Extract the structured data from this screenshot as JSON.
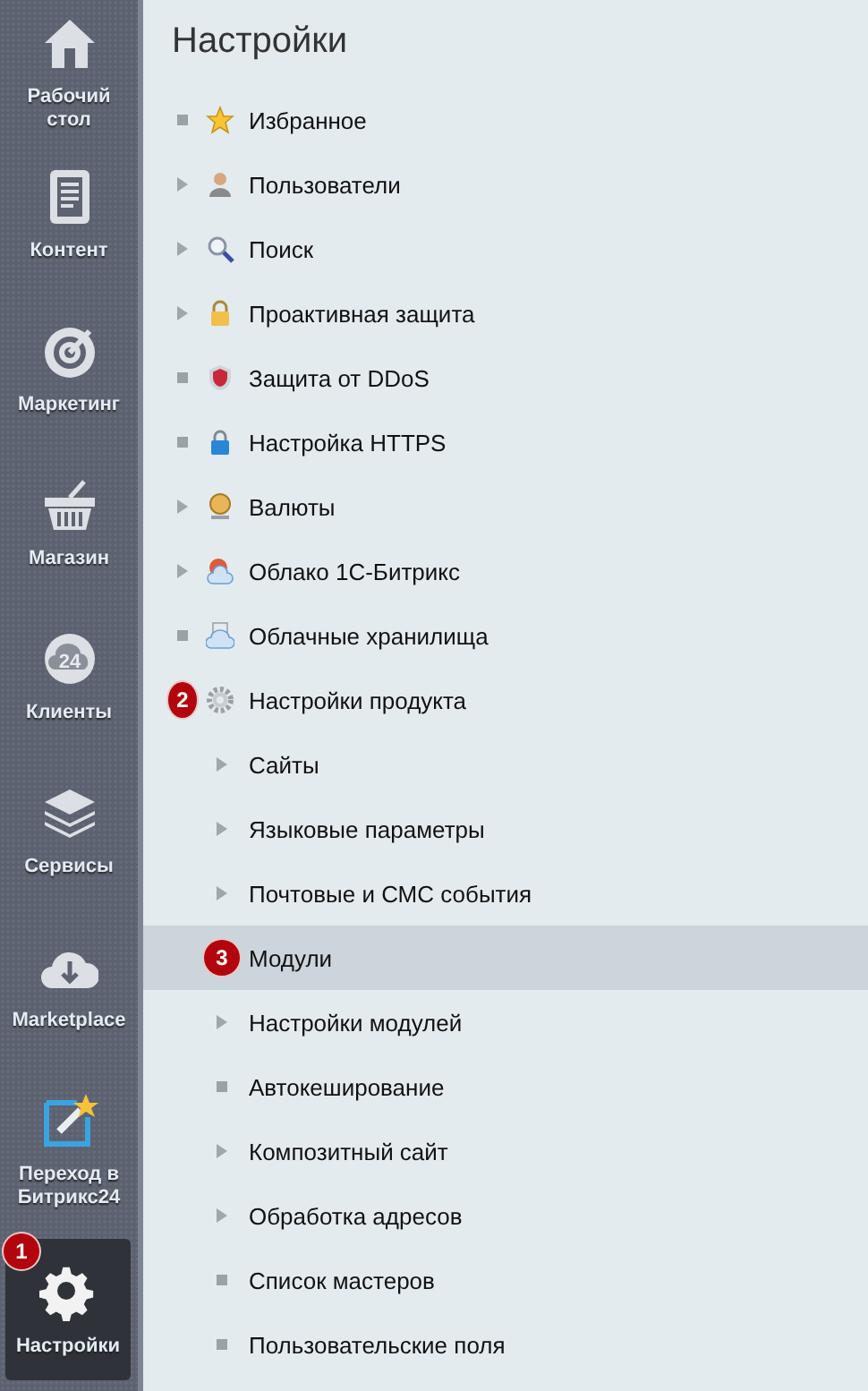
{
  "sidebar": {
    "items": [
      {
        "label": "Рабочий стол",
        "selected": false
      },
      {
        "label": "Контент",
        "selected": false
      },
      {
        "label": "Маркетинг",
        "selected": false
      },
      {
        "label": "Магазин",
        "selected": false
      },
      {
        "label": "Клиенты",
        "selected": false,
        "icon_text": "24"
      },
      {
        "label": "Сервисы",
        "selected": false
      },
      {
        "label": "Marketplace",
        "selected": false
      },
      {
        "label": "Переход в Битрикс24",
        "selected": false
      },
      {
        "label": "Настройки",
        "selected": true,
        "badge": "1"
      }
    ]
  },
  "title": "Настройки",
  "menu": {
    "items": [
      {
        "label": "Избранное",
        "kind": "dot",
        "selected": false
      },
      {
        "label": "Пользователи",
        "kind": "arrow",
        "selected": false
      },
      {
        "label": "Поиск",
        "kind": "arrow",
        "selected": false
      },
      {
        "label": "Проактивная защита",
        "kind": "arrow",
        "selected": false
      },
      {
        "label": "Защита от DDoS",
        "kind": "dot",
        "selected": false
      },
      {
        "label": "Настройка HTTPS",
        "kind": "dot",
        "selected": false
      },
      {
        "label": "Валюты",
        "kind": "arrow",
        "selected": false
      },
      {
        "label": "Облако 1С-Битрикс",
        "kind": "arrow",
        "selected": false
      },
      {
        "label": "Облачные хранилища",
        "kind": "dot",
        "selected": false
      },
      {
        "label": "Настройки продукта",
        "kind": "badged",
        "badge": "2",
        "selected": false,
        "children": [
          {
            "label": "Сайты",
            "kind": "arrow",
            "selected": false
          },
          {
            "label": "Языковые параметры",
            "kind": "arrow",
            "selected": false
          },
          {
            "label": "Почтовые и СМС события",
            "kind": "arrow",
            "selected": false
          },
          {
            "label": "Модули",
            "kind": "badged",
            "badge": "3",
            "selected": true
          },
          {
            "label": "Настройки модулей",
            "kind": "arrow",
            "selected": false
          },
          {
            "label": "Автокеширование",
            "kind": "dot",
            "selected": false
          },
          {
            "label": "Композитный сайт",
            "kind": "arrow",
            "selected": false
          },
          {
            "label": "Обработка адресов",
            "kind": "arrow",
            "selected": false
          },
          {
            "label": "Список мастеров",
            "kind": "dot",
            "selected": false
          },
          {
            "label": "Пользовательские поля",
            "kind": "dot",
            "selected": false
          }
        ]
      }
    ]
  }
}
